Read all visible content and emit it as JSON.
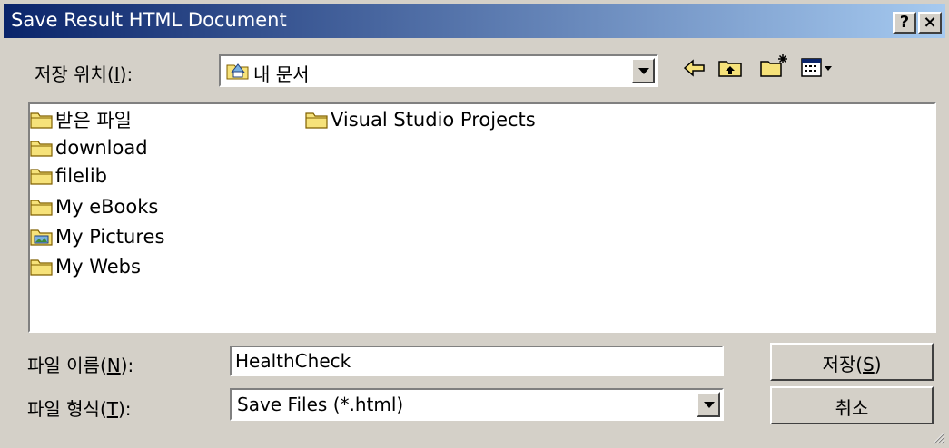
{
  "window": {
    "title": "Save Result HTML Document",
    "help_label": "?",
    "close_label": "×"
  },
  "location": {
    "label_prefix": "저장 위치(",
    "label_key": "I",
    "label_suffix": "):",
    "value": "내 문서",
    "icon": "my-documents-folder-icon"
  },
  "toolbar": {
    "back_icon": "back-arrow-icon",
    "up_icon": "up-one-level-icon",
    "new_folder_icon": "new-folder-icon",
    "view_menu_icon": "view-menu-icon"
  },
  "files": {
    "column1": [
      {
        "name": "받은 파일",
        "icon": "folder-icon"
      },
      {
        "name": "download",
        "icon": "folder-icon"
      },
      {
        "name": "filelib",
        "icon": "folder-icon"
      },
      {
        "name": "My eBooks",
        "icon": "folder-icon"
      },
      {
        "name": "My Pictures",
        "icon": "picture-folder-icon"
      },
      {
        "name": "My Webs",
        "icon": "folder-icon"
      }
    ],
    "column2": [
      {
        "name": "Visual Studio Projects",
        "icon": "folder-icon"
      }
    ]
  },
  "filename": {
    "label_prefix": "파일 이름(",
    "label_key": "N",
    "label_suffix": "):",
    "value": "HealthCheck"
  },
  "filetype": {
    "label_prefix": "파일 형식(",
    "label_key": "T",
    "label_suffix": "):",
    "value": "Save Files (*.html)"
  },
  "buttons": {
    "save_prefix": "저장(",
    "save_key": "S",
    "save_suffix": ")",
    "cancel": "취소"
  },
  "colors": {
    "titlebar_start": "#0a246a",
    "titlebar_end": "#a6caf0",
    "face": "#d4d0c8",
    "folder": "#f6e27a"
  }
}
